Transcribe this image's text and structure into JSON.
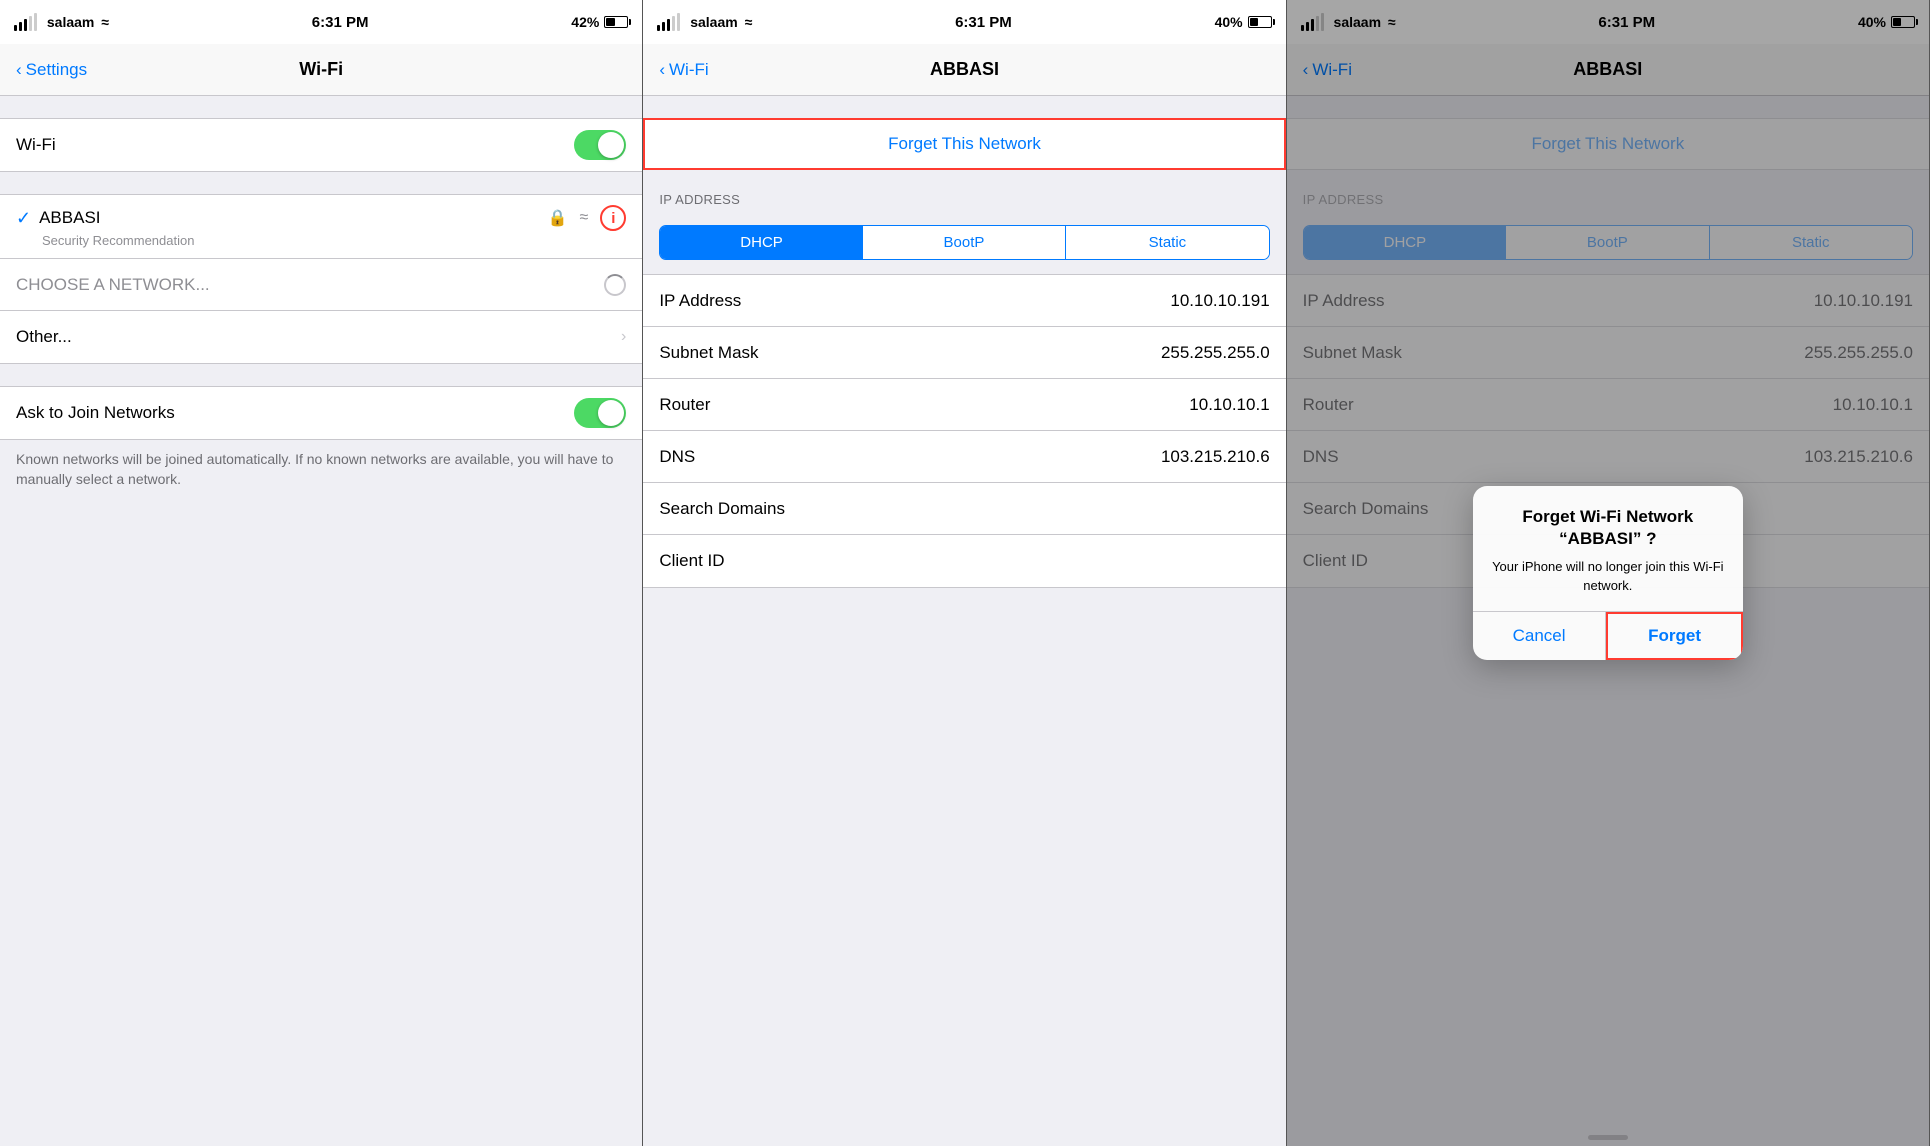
{
  "panel1": {
    "statusBar": {
      "carrier": "salaam",
      "time": "6:31 PM",
      "battery": "42%",
      "batteryPct": 42
    },
    "navBack": "Settings",
    "navTitle": "Wi-Fi",
    "rows": {
      "wifi_label": "Wi-Fi",
      "abbasi_name": "ABBASI",
      "abbasi_sub": "Security Recommendation",
      "choose_network": "CHOOSE A NETWORK...",
      "other": "Other...",
      "ask_to_join": "Ask to Join Networks",
      "ask_desc": "Known networks will be joined automatically. If no known networks are available, you will have to manually select a network."
    }
  },
  "panel2": {
    "statusBar": {
      "carrier": "salaam",
      "time": "6:31 PM",
      "battery": "40%",
      "batteryPct": 40
    },
    "navBack": "Wi-Fi",
    "navTitle": "ABBASI",
    "forget_label": "Forget This Network",
    "ip_address_header": "IP ADDRESS",
    "segments": [
      "DHCP",
      "BootP",
      "Static"
    ],
    "active_segment": "DHCP",
    "rows": [
      {
        "label": "IP Address",
        "value": "10.10.10.191"
      },
      {
        "label": "Subnet Mask",
        "value": "255.255.255.0"
      },
      {
        "label": "Router",
        "value": "10.10.10.1"
      },
      {
        "label": "DNS",
        "value": "103.215.210.6"
      },
      {
        "label": "Search Domains",
        "value": ""
      },
      {
        "label": "Client ID",
        "value": ""
      }
    ]
  },
  "panel3": {
    "statusBar": {
      "carrier": "salaam",
      "time": "6:31 PM",
      "battery": "40%",
      "batteryPct": 40
    },
    "navBack": "Wi-Fi",
    "navTitle": "ABBASI",
    "forget_label": "Forget This Network",
    "ip_address_header": "IP ADDRESS",
    "segments": [
      "DHCP",
      "BootP",
      "Static"
    ],
    "active_segment": "DHCP",
    "rows": [
      {
        "label": "IP Address",
        "value": "10.10.10.191"
      },
      {
        "label": "Subnet Mask",
        "value": "255.255.255.0"
      },
      {
        "label": "Router",
        "value": "10.10.10.1"
      },
      {
        "label": "DNS",
        "value": "103.215.210.6"
      },
      {
        "label": "Search Domains",
        "value": ""
      },
      {
        "label": "Client ID",
        "value": ""
      }
    ],
    "dialog": {
      "title": "Forget Wi-Fi Network “ABBASI” ?",
      "message": "Your iPhone will no longer join this Wi-Fi network.",
      "cancel": "Cancel",
      "forget": "Forget"
    }
  }
}
